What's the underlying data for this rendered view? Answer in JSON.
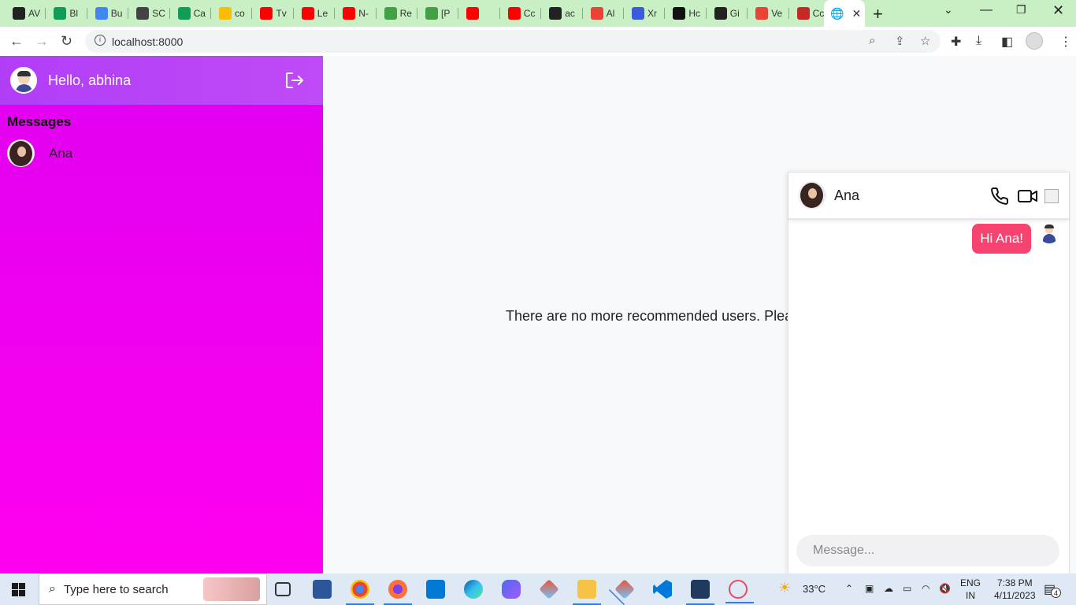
{
  "browser": {
    "tabs": [
      {
        "label": "AV",
        "color": "#222"
      },
      {
        "label": "Bl",
        "color": "#0f9d58"
      },
      {
        "label": "Bu",
        "color": "#4285f4"
      },
      {
        "label": "SC",
        "color": "#444"
      },
      {
        "label": "Ca",
        "color": "#0f9d58"
      },
      {
        "label": "co",
        "color": "#fbbc04"
      },
      {
        "label": "Tv",
        "color": "#ff0000"
      },
      {
        "label": "Le",
        "color": "#ff0000"
      },
      {
        "label": "N-",
        "color": "#ff0000"
      },
      {
        "label": "Re",
        "color": "#43a047"
      },
      {
        "label": "[P",
        "color": "#43a047"
      },
      {
        "label": "",
        "color": "#ff0000"
      },
      {
        "label": "Cc",
        "color": "#ff0000"
      },
      {
        "label": "ac",
        "color": "#222"
      },
      {
        "label": "Al",
        "color": "#ea4335"
      },
      {
        "label": "Xr",
        "color": "#3b5bdb"
      },
      {
        "label": "Hc",
        "color": "#111"
      },
      {
        "label": "Gi",
        "color": "#222"
      },
      {
        "label": "Ve",
        "color": "#ea4335"
      },
      {
        "label": "Cc",
        "color": "#c62828"
      }
    ],
    "address": "localhost:8000"
  },
  "sidebar": {
    "greeting": "Hello, abhina",
    "section_title": "Messages",
    "contacts": [
      {
        "name": "Ana"
      }
    ]
  },
  "main": {
    "empty_message": "There are no more recommended users. Please"
  },
  "chat": {
    "contact_name": "Ana",
    "messages": [
      {
        "text": "Hi Ana!",
        "from": "me"
      }
    ],
    "input_placeholder": "Message..."
  },
  "taskbar": {
    "search_placeholder": "Type here to search",
    "weather": "33°C",
    "language_top": "ENG",
    "language_bottom": "IN",
    "time": "7:38 PM",
    "date": "4/11/2023",
    "notification_count": "4"
  },
  "colors": {
    "sidebar": "#ff00f0",
    "sidebar_header": "#b13ef7",
    "bubble": "#f7436f"
  }
}
